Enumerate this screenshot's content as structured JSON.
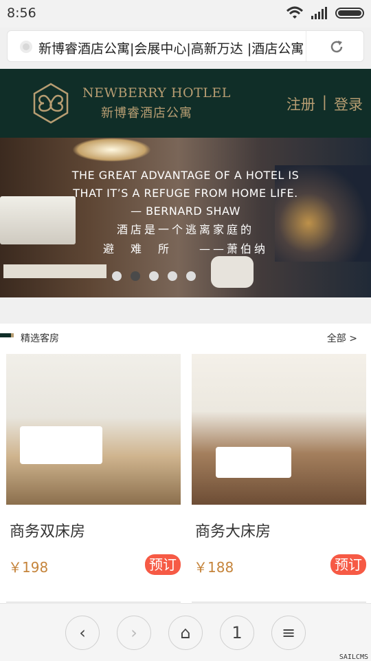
{
  "status": {
    "time": "8:56"
  },
  "browser": {
    "url_text": "新博睿酒店公寓|会展中心|高新万达 |酒店公寓"
  },
  "header": {
    "brand_en": "NEWBERRY HOTLEL",
    "brand_cn": "新博睿酒店公寓",
    "register": "注册",
    "separator": "|",
    "login": "登录",
    "brand_color": "#b79d72",
    "header_bg": "#102e28"
  },
  "banner": {
    "quote_en_1": "THE GREAT ADVANTAGE OF A HOTEL IS",
    "quote_en_2": "THAT IT’S A REFUGE FROM HOME LIFE.",
    "quote_en_3": "— BERNARD SHAW",
    "quote_cn_1": "酒店是一个逃离家庭的",
    "quote_cn_2": "避　难　所　　——萧伯纳",
    "active_dot": 2
  },
  "section": {
    "title": "精选客房",
    "all": "全部",
    "chevron": ">"
  },
  "rooms": [
    {
      "name": "商务双床房",
      "price": "￥198",
      "book": "预订"
    },
    {
      "name": "商务大床房",
      "price": "￥188",
      "book": "预订"
    }
  ],
  "bottom_nav": {
    "back": "‹",
    "forward": "›",
    "home": "⌂",
    "tabs": "1",
    "menu": "≡"
  },
  "watermark": "SAILCMS"
}
